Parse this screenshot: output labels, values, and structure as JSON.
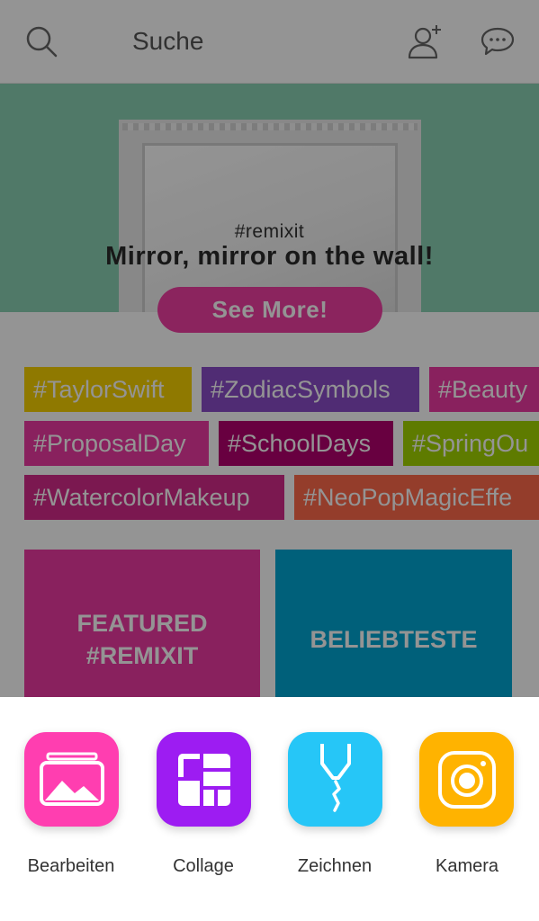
{
  "search": {
    "label": "Suche"
  },
  "banner": {
    "hashtag": "#remixit",
    "title": "Mirror, mirror on the wall!",
    "button_label": "See More!"
  },
  "tags": [
    {
      "label": "#TaylorSwift",
      "color": "#f7d000"
    },
    {
      "label": "#ZodiacSymbols",
      "color": "#8a4cc8"
    },
    {
      "label": "#Beauty",
      "color": "#ec3aa2"
    },
    {
      "label": "#ProposalDay",
      "color": "#ec3aa2"
    },
    {
      "label": "#SchoolDays",
      "color": "#b3006e"
    },
    {
      "label": "#SpringOu",
      "color": "#a3d400"
    },
    {
      "label": "#WatercolorMakeup",
      "color": "#d42a8a"
    },
    {
      "label": "#NeoPopMagicEffe",
      "color": "#ff6a4a"
    }
  ],
  "tiles": {
    "featured_line1": "FEATURED",
    "featured_line2": "#REMIXIT",
    "popular": "BELIEBTESTE"
  },
  "tools": [
    {
      "label": "Bearbeiten",
      "icon": "image-edit-icon",
      "color": "#ff3eb0"
    },
    {
      "label": "Collage",
      "icon": "collage-grid-icon",
      "color": "#9d1cf2"
    },
    {
      "label": "Zeichnen",
      "icon": "draw-pen-icon",
      "color": "#26c6f7"
    },
    {
      "label": "Kamera",
      "icon": "camera-icon",
      "color": "#ffb300"
    }
  ]
}
